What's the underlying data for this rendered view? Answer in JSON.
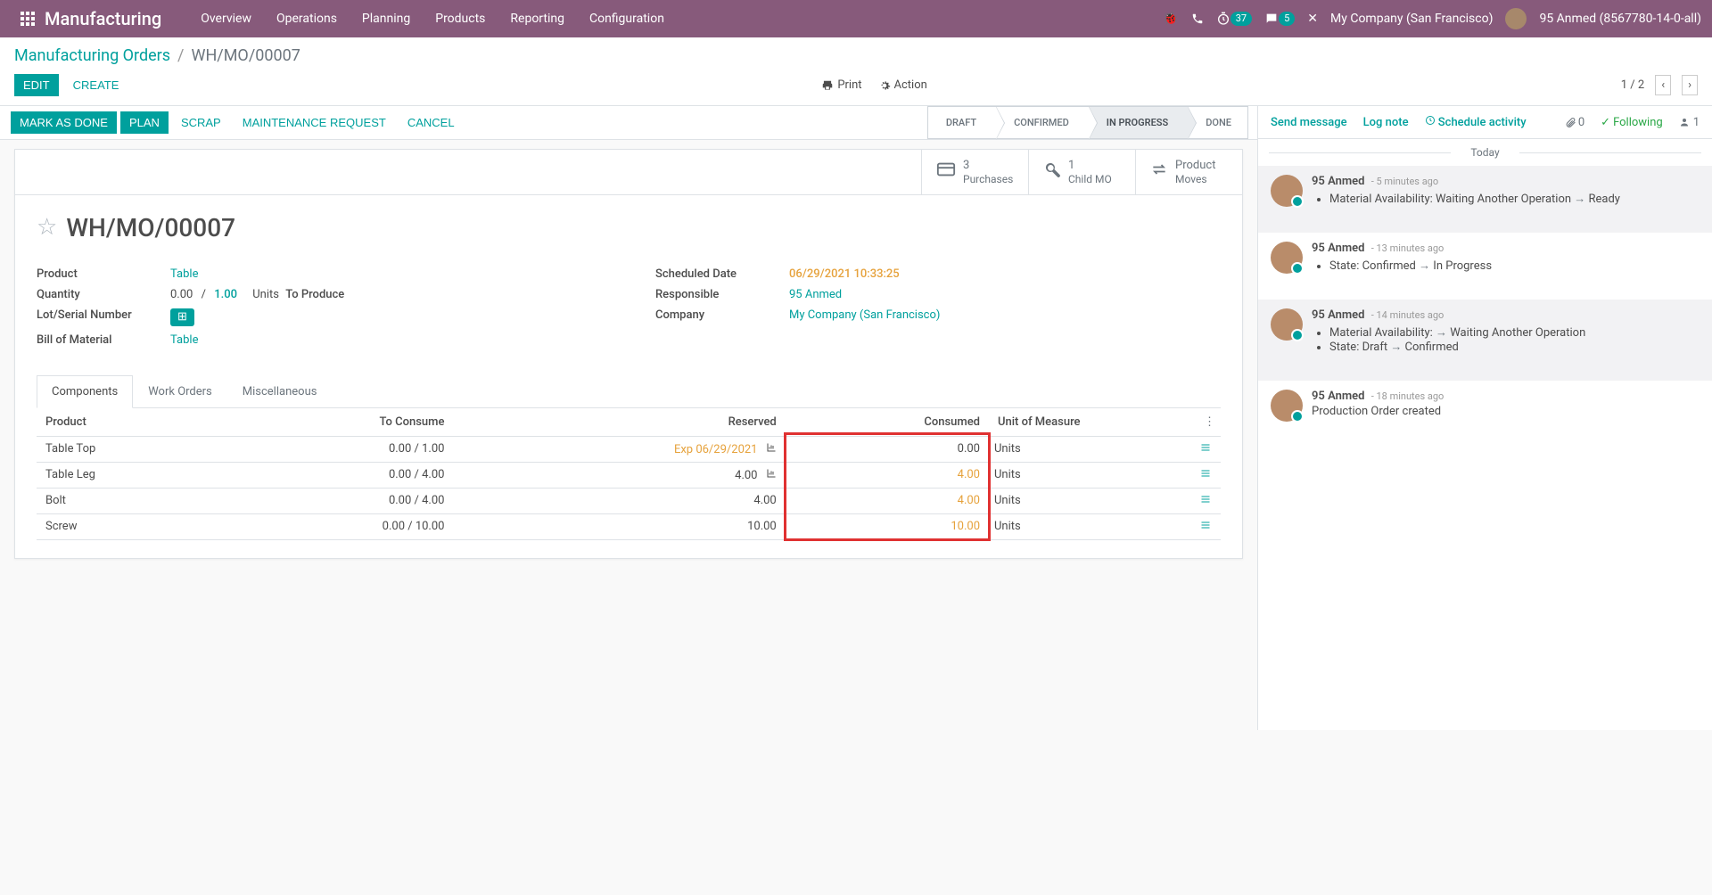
{
  "topnav": {
    "brand": "Manufacturing",
    "menu": [
      "Overview",
      "Operations",
      "Planning",
      "Products",
      "Reporting",
      "Configuration"
    ],
    "badge_timer": "37",
    "badge_msg": "5",
    "company": "My Company (San Francisco)",
    "user": "95 Anmed (8567780-14-0-all)"
  },
  "breadcrumb": {
    "root": "Manufacturing Orders",
    "sep": "/",
    "current": "WH/MO/00007"
  },
  "edit_btn": "EDIT",
  "create_btn": "CREATE",
  "print_btn": "Print",
  "action_btn": "Action",
  "pager": "1 / 2",
  "statusbar": {
    "mark_done": "MARK AS DONE",
    "plan": "PLAN",
    "scrap": "SCRAP",
    "maint": "MAINTENANCE REQUEST",
    "cancel": "CANCEL",
    "stages": [
      "DRAFT",
      "CONFIRMED",
      "IN PROGRESS",
      "DONE"
    ],
    "active_idx": 2
  },
  "stat_buttons": [
    {
      "num": "3",
      "label": "Purchases",
      "icon": "credit"
    },
    {
      "num": "1",
      "label": "Child MO",
      "icon": "wrench"
    },
    {
      "num": "Product",
      "label": "Moves",
      "icon": "swap"
    }
  ],
  "record": {
    "name": "WH/MO/00007",
    "labels": {
      "product": "Product",
      "quantity": "Quantity",
      "lot": "Lot/Serial Number",
      "bom": "Bill of Material",
      "sched": "Scheduled Date",
      "responsible": "Responsible",
      "company": "Company"
    },
    "product": "Table",
    "qty_done": "0.00",
    "qty_sep": "/",
    "qty_planned": "1.00",
    "uom": "Units",
    "to_produce": "To Produce",
    "bom": "Table",
    "sched_date": "06/29/2021 10:33:25",
    "responsible": "95 Anmed",
    "company": "My Company (San Francisco)"
  },
  "tabs": [
    "Components",
    "Work Orders",
    "Miscellaneous"
  ],
  "columns": {
    "product": "Product",
    "to_consume": "To Consume",
    "reserved": "Reserved",
    "consumed": "Consumed",
    "uom": "Unit of Measure"
  },
  "rows": [
    {
      "product": "Table Top",
      "to_consume": "0.00 / 1.00",
      "reserved": "Exp 06/29/2021",
      "reserved_chart": true,
      "reserved_exp": true,
      "consumed": "0.00",
      "consumed_hl": false,
      "uom": "Units"
    },
    {
      "product": "Table Leg",
      "to_consume": "0.00 / 4.00",
      "reserved": "4.00",
      "reserved_chart": true,
      "reserved_exp": false,
      "consumed": "4.00",
      "consumed_hl": true,
      "uom": "Units"
    },
    {
      "product": "Bolt",
      "to_consume": "0.00 / 4.00",
      "reserved": "4.00",
      "reserved_chart": false,
      "reserved_exp": false,
      "consumed": "4.00",
      "consumed_hl": true,
      "uom": "Units"
    },
    {
      "product": "Screw",
      "to_consume": "0.00 / 10.00",
      "reserved": "10.00",
      "reserved_chart": false,
      "reserved_exp": false,
      "consumed": "10.00",
      "consumed_hl": true,
      "uom": "Units"
    }
  ],
  "chatter": {
    "send": "Send message",
    "log": "Log note",
    "schedule": "Schedule activity",
    "attach_count": "0",
    "following": "Following",
    "follower_count": "1",
    "today": "Today",
    "messages": [
      {
        "author": "95 Anmed",
        "time": "- 5 minutes ago",
        "note": true,
        "items": [
          "Material Availability: Waiting Another Operation → Ready"
        ]
      },
      {
        "author": "95 Anmed",
        "time": "- 13 minutes ago",
        "note": false,
        "items": [
          "State: Confirmed → In Progress"
        ]
      },
      {
        "author": "95 Anmed",
        "time": "- 14 minutes ago",
        "note": true,
        "items": [
          "Material Availability: → Waiting Another Operation",
          "State: Draft → Confirmed"
        ]
      },
      {
        "author": "95 Anmed",
        "time": "- 18 minutes ago",
        "note": false,
        "text": "Production Order created"
      }
    ]
  }
}
